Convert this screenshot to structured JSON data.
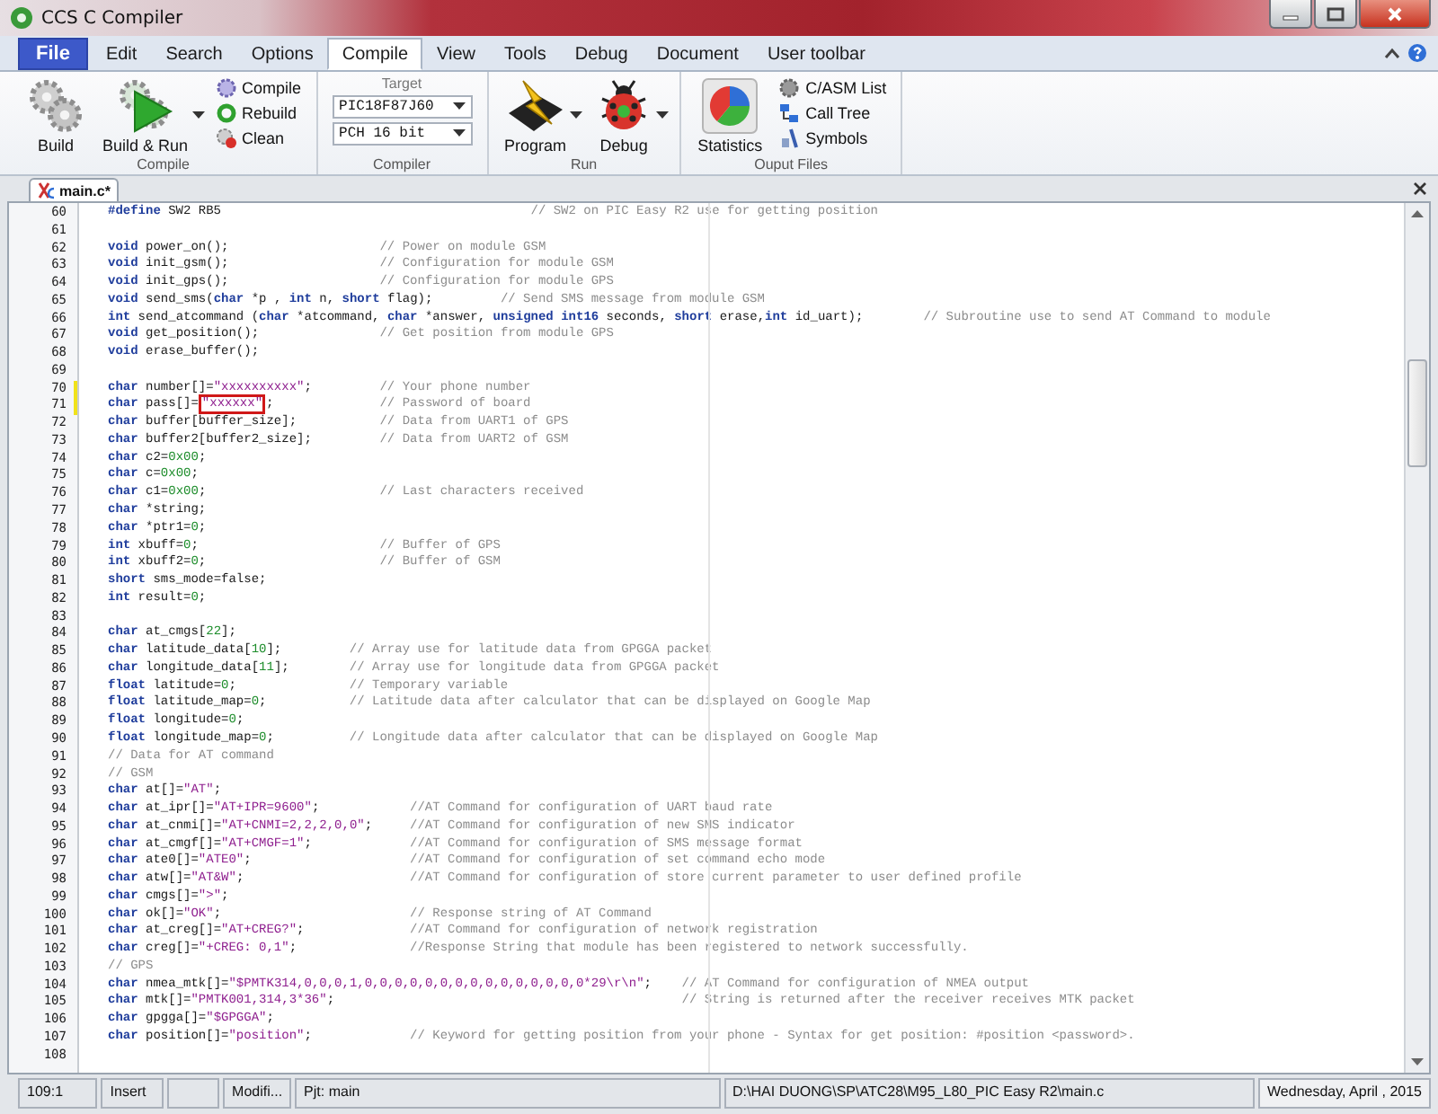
{
  "window": {
    "title": "CCS C Compiler"
  },
  "menu": {
    "file": "File",
    "tabs": [
      {
        "label": "Edit",
        "selected": false
      },
      {
        "label": "Search",
        "selected": false
      },
      {
        "label": "Options",
        "selected": false
      },
      {
        "label": "Compile",
        "selected": true
      },
      {
        "label": "View",
        "selected": false
      },
      {
        "label": "Tools",
        "selected": false
      },
      {
        "label": "Debug",
        "selected": false
      },
      {
        "label": "Document",
        "selected": false
      },
      {
        "label": "User toolbar",
        "selected": false
      }
    ]
  },
  "ribbon": {
    "groups": [
      {
        "label": "Compile",
        "items": [
          {
            "kind": "large",
            "label": "Build",
            "has_menu": false
          },
          {
            "kind": "large",
            "label": "Build & Run",
            "has_menu": true
          },
          {
            "kind": "small",
            "label": "Compile"
          },
          {
            "kind": "small",
            "label": "Rebuild"
          },
          {
            "kind": "small",
            "label": "Clean"
          }
        ]
      },
      {
        "label": "Compiler",
        "items": [
          {
            "kind": "dropdown",
            "caption": "Target",
            "value": "PIC18F87J60"
          },
          {
            "kind": "dropdown",
            "value": "PCH 16 bit"
          }
        ]
      },
      {
        "label": "Run",
        "items": [
          {
            "kind": "large",
            "label": "Program",
            "has_menu": true
          },
          {
            "kind": "large",
            "label": "Debug",
            "has_menu": true
          }
        ]
      },
      {
        "label": "Ouput Files",
        "items": [
          {
            "kind": "large",
            "label": "Statistics",
            "has_menu": false
          },
          {
            "kind": "small",
            "label": "C/ASM List"
          },
          {
            "kind": "small",
            "label": "Call Tree"
          },
          {
            "kind": "small",
            "label": "Symbols"
          }
        ]
      }
    ]
  },
  "document_tabs": [
    {
      "label": "main.c*",
      "selected": true
    }
  ],
  "editor": {
    "lines": [
      {
        "number": "60",
        "modified": false,
        "tokens": [
          {
            "kind": "kw",
            "text": "#define"
          },
          {
            "kind": "txt",
            "text": " SW2 RB5\t\t\t\t\t\t\t\t\t\t\t"
          },
          {
            "kind": "cmt",
            "text": "// SW2 on PIC Easy R2 use for getting position"
          }
        ]
      },
      {
        "number": "61",
        "modified": false
      },
      {
        "number": "62",
        "modified": false,
        "tokens": [
          {
            "kind": "kw",
            "text": "void"
          },
          {
            "kind": "txt",
            "text": " power_on();\t\t\t\t\t"
          },
          {
            "kind": "cmt",
            "text": "// Power on module GSM"
          }
        ]
      },
      {
        "number": "63",
        "modified": false,
        "tokens": [
          {
            "kind": "kw",
            "text": "void"
          },
          {
            "kind": "txt",
            "text": " init_gsm();\t\t\t\t\t"
          },
          {
            "kind": "cmt",
            "text": "// Configuration for module GSM"
          }
        ]
      },
      {
        "number": "64",
        "modified": false,
        "tokens": [
          {
            "kind": "kw",
            "text": "void"
          },
          {
            "kind": "txt",
            "text": " init_gps();\t\t\t\t\t"
          },
          {
            "kind": "cmt",
            "text": "// Configuration for module GPS"
          }
        ]
      },
      {
        "number": "65",
        "modified": false,
        "tokens": [
          {
            "kind": "kw",
            "text": "void"
          },
          {
            "kind": "txt",
            "text": " send_sms("
          },
          {
            "kind": "kw",
            "text": "char"
          },
          {
            "kind": "txt",
            "text": " *p , "
          },
          {
            "kind": "kw",
            "text": "int"
          },
          {
            "kind": "txt",
            "text": " n, "
          },
          {
            "kind": "kw",
            "text": "short"
          },
          {
            "kind": "txt",
            "text": " flag);\t\t\t"
          },
          {
            "kind": "cmt",
            "text": "// Send SMS message from module GSM"
          }
        ]
      },
      {
        "number": "66",
        "modified": false,
        "tokens": [
          {
            "kind": "kw",
            "text": "int"
          },
          {
            "kind": "txt",
            "text": " send_atcommand ("
          },
          {
            "kind": "kw",
            "text": "char"
          },
          {
            "kind": "txt",
            "text": " *atcommand, "
          },
          {
            "kind": "kw",
            "text": "char"
          },
          {
            "kind": "txt",
            "text": " *answer, "
          },
          {
            "kind": "kw",
            "text": "unsigned int16"
          },
          {
            "kind": "txt",
            "text": " seconds, "
          },
          {
            "kind": "kw",
            "text": "short"
          },
          {
            "kind": "txt",
            "text": " erase,"
          },
          {
            "kind": "kw",
            "text": "int"
          },
          {
            "kind": "txt",
            "text": " id_uart);\t\t"
          },
          {
            "kind": "cmt",
            "text": "// Subroutine use to send AT Command to module"
          }
        ]
      },
      {
        "number": "67",
        "modified": false,
        "tokens": [
          {
            "kind": "kw",
            "text": "void"
          },
          {
            "kind": "txt",
            "text": " get_position();\t\t\t\t"
          },
          {
            "kind": "cmt",
            "text": "// Get position from module GPS"
          }
        ]
      },
      {
        "number": "68",
        "modified": false,
        "tokens": [
          {
            "kind": "kw",
            "text": "void"
          },
          {
            "kind": "txt",
            "text": " erase_buffer();"
          }
        ]
      },
      {
        "number": "69",
        "modified": false
      },
      {
        "number": "70",
        "modified": true,
        "tokens": [
          {
            "kind": "kw",
            "text": "char"
          },
          {
            "kind": "txt",
            "text": " number[]="
          },
          {
            "kind": "str",
            "text": "\"xxxxxxxxxx\""
          },
          {
            "kind": "txt",
            "text": ";\t\t\t"
          },
          {
            "kind": "cmt",
            "text": "// Your phone number"
          }
        ]
      },
      {
        "number": "71",
        "modified": true,
        "tokens": [
          {
            "kind": "kw",
            "text": "char"
          },
          {
            "kind": "txt",
            "text": " pass[]="
          },
          {
            "kind": "str_boxed",
            "text": "\"xxxxxx\""
          },
          {
            "kind": "txt",
            "text": ";\t\t\t\t"
          },
          {
            "kind": "cmt",
            "text": "// Password of board"
          }
        ]
      },
      {
        "number": "72",
        "modified": false,
        "tokens": [
          {
            "kind": "kw",
            "text": "char"
          },
          {
            "kind": "txt",
            "text": " buffer[buffer_size];\t\t\t"
          },
          {
            "kind": "cmt",
            "text": "// Data from UART1 of GPS"
          }
        ]
      },
      {
        "number": "73",
        "modified": false,
        "tokens": [
          {
            "kind": "kw",
            "text": "char"
          },
          {
            "kind": "txt",
            "text": " buffer2[buffer2_size];\t\t\t"
          },
          {
            "kind": "cmt",
            "text": "// Data from UART2 of GSM"
          }
        ]
      },
      {
        "number": "74",
        "modified": false,
        "tokens": [
          {
            "kind": "kw",
            "text": "char"
          },
          {
            "kind": "txt",
            "text": " c2="
          },
          {
            "kind": "num",
            "text": "0x00"
          },
          {
            "kind": "txt",
            "text": ";"
          }
        ]
      },
      {
        "number": "75",
        "modified": false,
        "tokens": [
          {
            "kind": "kw",
            "text": "char"
          },
          {
            "kind": "txt",
            "text": " c="
          },
          {
            "kind": "num",
            "text": "0x00"
          },
          {
            "kind": "txt",
            "text": ";"
          }
        ]
      },
      {
        "number": "76",
        "modified": false,
        "tokens": [
          {
            "kind": "kw",
            "text": "char"
          },
          {
            "kind": "txt",
            "text": " c1="
          },
          {
            "kind": "num",
            "text": "0x00"
          },
          {
            "kind": "txt",
            "text": ";\t\t\t\t\t\t"
          },
          {
            "kind": "cmt",
            "text": "// Last characters received"
          }
        ]
      },
      {
        "number": "77",
        "modified": false,
        "tokens": [
          {
            "kind": "kw",
            "text": "char"
          },
          {
            "kind": "txt",
            "text": " *string;"
          }
        ]
      },
      {
        "number": "78",
        "modified": false,
        "tokens": [
          {
            "kind": "kw",
            "text": "char"
          },
          {
            "kind": "txt",
            "text": " *ptr1="
          },
          {
            "kind": "num",
            "text": "0"
          },
          {
            "kind": "txt",
            "text": ";"
          }
        ]
      },
      {
        "number": "79",
        "modified": false,
        "tokens": [
          {
            "kind": "kw",
            "text": "int"
          },
          {
            "kind": "txt",
            "text": " xbuff="
          },
          {
            "kind": "num",
            "text": "0"
          },
          {
            "kind": "txt",
            "text": ";\t\t\t\t\t\t"
          },
          {
            "kind": "cmt",
            "text": "// Buffer of GPS"
          }
        ]
      },
      {
        "number": "80",
        "modified": false,
        "tokens": [
          {
            "kind": "kw",
            "text": "int"
          },
          {
            "kind": "txt",
            "text": " xbuff2="
          },
          {
            "kind": "num",
            "text": "0"
          },
          {
            "kind": "txt",
            "text": ";\t\t\t\t\t\t"
          },
          {
            "kind": "cmt",
            "text": "// Buffer of GSM"
          }
        ]
      },
      {
        "number": "81",
        "modified": false,
        "tokens": [
          {
            "kind": "kw",
            "text": "short"
          },
          {
            "kind": "txt",
            "text": " sms_mode=false;"
          }
        ]
      },
      {
        "number": "82",
        "modified": false,
        "tokens": [
          {
            "kind": "kw",
            "text": "int"
          },
          {
            "kind": "txt",
            "text": " result="
          },
          {
            "kind": "num",
            "text": "0"
          },
          {
            "kind": "txt",
            "text": ";"
          }
        ]
      },
      {
        "number": "83",
        "modified": false
      },
      {
        "number": "84",
        "modified": false,
        "tokens": [
          {
            "kind": "kw",
            "text": "char"
          },
          {
            "kind": "txt",
            "text": " at_cmgs["
          },
          {
            "kind": "num",
            "text": "22"
          },
          {
            "kind": "txt",
            "text": "];"
          }
        ]
      },
      {
        "number": "85",
        "modified": false,
        "tokens": [
          {
            "kind": "kw",
            "text": "char"
          },
          {
            "kind": "txt",
            "text": " latitude_data["
          },
          {
            "kind": "num",
            "text": "10"
          },
          {
            "kind": "txt",
            "text": "];\t\t\t"
          },
          {
            "kind": "cmt",
            "text": "// Array use for latitude data from GPGGA packet"
          }
        ]
      },
      {
        "number": "86",
        "modified": false,
        "tokens": [
          {
            "kind": "kw",
            "text": "char"
          },
          {
            "kind": "txt",
            "text": " longitude_data["
          },
          {
            "kind": "num",
            "text": "11"
          },
          {
            "kind": "txt",
            "text": "];\t\t"
          },
          {
            "kind": "cmt",
            "text": "// Array use for longitude data from GPGGA packet"
          }
        ]
      },
      {
        "number": "87",
        "modified": false,
        "tokens": [
          {
            "kind": "kw",
            "text": "float"
          },
          {
            "kind": "txt",
            "text": " latitude="
          },
          {
            "kind": "num",
            "text": "0"
          },
          {
            "kind": "txt",
            "text": ";\t\t\t\t"
          },
          {
            "kind": "cmt",
            "text": "// Temporary variable"
          }
        ]
      },
      {
        "number": "88",
        "modified": false,
        "tokens": [
          {
            "kind": "kw",
            "text": "float"
          },
          {
            "kind": "txt",
            "text": " latitude_map="
          },
          {
            "kind": "num",
            "text": "0"
          },
          {
            "kind": "txt",
            "text": ";\t\t\t"
          },
          {
            "kind": "cmt",
            "text": "// Latitude data after calculator that can be displayed on Google Map"
          }
        ]
      },
      {
        "number": "89",
        "modified": false,
        "tokens": [
          {
            "kind": "kw",
            "text": "float"
          },
          {
            "kind": "txt",
            "text": " longitude="
          },
          {
            "kind": "num",
            "text": "0"
          },
          {
            "kind": "txt",
            "text": ";"
          }
        ]
      },
      {
        "number": "90",
        "modified": false,
        "tokens": [
          {
            "kind": "kw",
            "text": "float"
          },
          {
            "kind": "txt",
            "text": " longitude_map="
          },
          {
            "kind": "num",
            "text": "0"
          },
          {
            "kind": "txt",
            "text": ";\t\t\t"
          },
          {
            "kind": "cmt",
            "text": "// Longitude data after calculator that can be displayed on Google Map"
          }
        ]
      },
      {
        "number": "91",
        "modified": false,
        "tokens": [
          {
            "kind": "cmt",
            "text": "// Data for AT command"
          }
        ]
      },
      {
        "number": "92",
        "modified": false,
        "tokens": [
          {
            "kind": "cmt",
            "text": "// GSM"
          }
        ]
      },
      {
        "number": "93",
        "modified": false,
        "tokens": [
          {
            "kind": "kw",
            "text": "char"
          },
          {
            "kind": "txt",
            "text": " at[]="
          },
          {
            "kind": "str",
            "text": "\"AT\""
          },
          {
            "kind": "txt",
            "text": ";"
          }
        ]
      },
      {
        "number": "94",
        "modified": false,
        "tokens": [
          {
            "kind": "kw",
            "text": "char"
          },
          {
            "kind": "txt",
            "text": " at_ipr[]="
          },
          {
            "kind": "str",
            "text": "\"AT+IPR=9600\""
          },
          {
            "kind": "txt",
            "text": ";\t\t\t"
          },
          {
            "kind": "cmt",
            "text": "//AT Command for configuration of UART baud rate"
          }
        ]
      },
      {
        "number": "95",
        "modified": false,
        "tokens": [
          {
            "kind": "kw",
            "text": "char"
          },
          {
            "kind": "txt",
            "text": " at_cnmi[]="
          },
          {
            "kind": "str",
            "text": "\"AT+CNMI=2,2,2,0,0\""
          },
          {
            "kind": "txt",
            "text": ";\t\t"
          },
          {
            "kind": "cmt",
            "text": "//AT Command for configuration of new SMS indicator"
          }
        ]
      },
      {
        "number": "96",
        "modified": false,
        "tokens": [
          {
            "kind": "kw",
            "text": "char"
          },
          {
            "kind": "txt",
            "text": " at_cmgf[]="
          },
          {
            "kind": "str",
            "text": "\"AT+CMGF=1\""
          },
          {
            "kind": "txt",
            "text": ";\t\t\t\t"
          },
          {
            "kind": "cmt",
            "text": "//AT Command for configuration of SMS message format"
          }
        ]
      },
      {
        "number": "97",
        "modified": false,
        "tokens": [
          {
            "kind": "kw",
            "text": "char"
          },
          {
            "kind": "txt",
            "text": " ate0[]="
          },
          {
            "kind": "str",
            "text": "\"ATE0\""
          },
          {
            "kind": "txt",
            "text": ";\t\t\t\t\t\t"
          },
          {
            "kind": "cmt",
            "text": "//AT Command for configuration of set command echo mode"
          }
        ]
      },
      {
        "number": "98",
        "modified": false,
        "tokens": [
          {
            "kind": "kw",
            "text": "char"
          },
          {
            "kind": "txt",
            "text": " atw[]="
          },
          {
            "kind": "str",
            "text": "\"AT&W\""
          },
          {
            "kind": "txt",
            "text": ";\t\t\t\t\t\t"
          },
          {
            "kind": "cmt",
            "text": "//AT Command for configuration of store current parameter to user defined profile"
          }
        ]
      },
      {
        "number": "99",
        "modified": false,
        "tokens": [
          {
            "kind": "kw",
            "text": "char"
          },
          {
            "kind": "txt",
            "text": " cmgs[]="
          },
          {
            "kind": "str",
            "text": "\">\""
          },
          {
            "kind": "txt",
            "text": ";"
          }
        ]
      },
      {
        "number": "100",
        "modified": false,
        "tokens": [
          {
            "kind": "kw",
            "text": "char"
          },
          {
            "kind": "txt",
            "text": " ok[]="
          },
          {
            "kind": "str",
            "text": "\"OK\""
          },
          {
            "kind": "txt",
            "text": ";\t\t\t\t\t\t\t"
          },
          {
            "kind": "cmt",
            "text": "// Response string of AT Command"
          }
        ]
      },
      {
        "number": "101",
        "modified": false,
        "tokens": [
          {
            "kind": "kw",
            "text": "char"
          },
          {
            "kind": "txt",
            "text": " at_creg[]="
          },
          {
            "kind": "str",
            "text": "\"AT+CREG?\""
          },
          {
            "kind": "txt",
            "text": ";\t\t\t\t"
          },
          {
            "kind": "cmt",
            "text": "//AT Command for configuration of network registration"
          }
        ]
      },
      {
        "number": "102",
        "modified": false,
        "tokens": [
          {
            "kind": "kw",
            "text": "char"
          },
          {
            "kind": "txt",
            "text": " creg[]="
          },
          {
            "kind": "str",
            "text": "\"+CREG: 0,1\""
          },
          {
            "kind": "txt",
            "text": ";\t\t\t\t"
          },
          {
            "kind": "cmt",
            "text": "//Response String that module has been registered to network successfully."
          }
        ]
      },
      {
        "number": "103",
        "modified": false,
        "tokens": [
          {
            "kind": "cmt",
            "text": "// GPS"
          }
        ]
      },
      {
        "number": "104",
        "modified": false,
        "tokens": [
          {
            "kind": "kw",
            "text": "char"
          },
          {
            "kind": "txt",
            "text": " nmea_mtk[]="
          },
          {
            "kind": "str",
            "text": "\"$PMTK314,0,0,0,1,0,0,0,0,0,0,0,0,0,0,0,0,0,0,0*29\\r\\n\""
          },
          {
            "kind": "txt",
            "text": ";\t"
          },
          {
            "kind": "cmt",
            "text": "// AT Command for configuration of NMEA output"
          }
        ]
      },
      {
        "number": "105",
        "modified": false,
        "tokens": [
          {
            "kind": "kw",
            "text": "char"
          },
          {
            "kind": "txt",
            "text": " mtk[]="
          },
          {
            "kind": "str",
            "text": "\"PMTK001,314,3*36\""
          },
          {
            "kind": "txt",
            "text": ";\t\t\t\t\t\t\t\t\t\t\t\t"
          },
          {
            "kind": "cmt",
            "text": "// String is returned after the receiver receives MTK packet"
          }
        ]
      },
      {
        "number": "106",
        "modified": false,
        "tokens": [
          {
            "kind": "kw",
            "text": "char"
          },
          {
            "kind": "txt",
            "text": " gpgga[]="
          },
          {
            "kind": "str",
            "text": "\"$GPGGA\""
          },
          {
            "kind": "txt",
            "text": ";"
          }
        ]
      },
      {
        "number": "107",
        "modified": false,
        "tokens": [
          {
            "kind": "kw",
            "text": "char"
          },
          {
            "kind": "txt",
            "text": " position[]="
          },
          {
            "kind": "str",
            "text": "\"position\""
          },
          {
            "kind": "txt",
            "text": ";\t\t\t\t"
          },
          {
            "kind": "cmt",
            "text": "// Keyword for getting position from your phone - Syntax for get position: #position <password>."
          }
        ]
      },
      {
        "number": "108",
        "modified": false
      }
    ]
  },
  "status_bar": [
    {
      "kind": "position",
      "text": "109:1"
    },
    {
      "kind": "mode",
      "text": "Insert"
    },
    {
      "kind": "blank"
    },
    {
      "kind": "state",
      "text": "Modifi..."
    },
    {
      "kind": "project",
      "text": "Pjt: main"
    },
    {
      "kind": "path",
      "text": "D:\\HAI DUONG\\SP\\ATC28\\M95_L80_PIC Easy R2\\main.c"
    },
    {
      "kind": "date",
      "text": "Wednesday, April , 2015"
    }
  ]
}
